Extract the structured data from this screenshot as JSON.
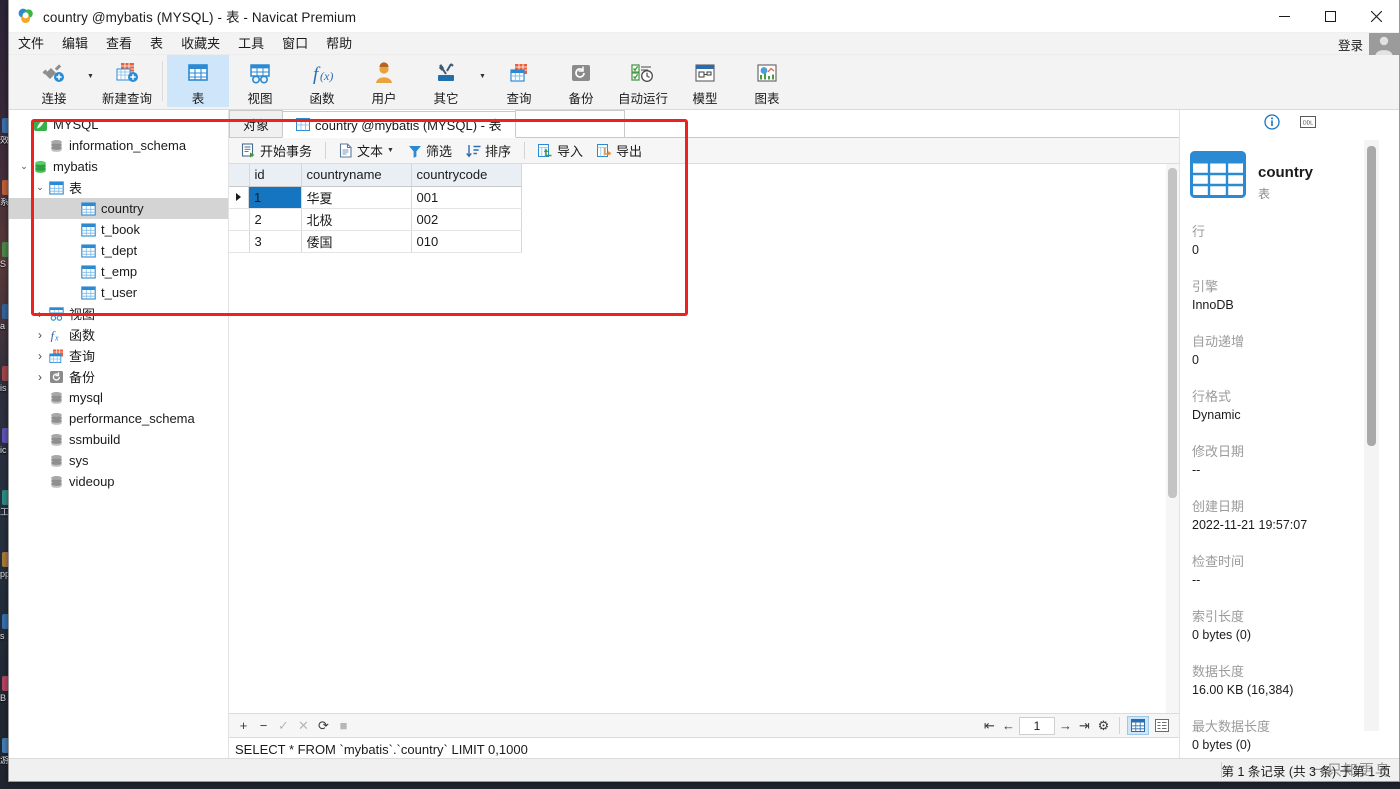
{
  "window": {
    "title": "country @mybatis (MYSQL) - 表 - Navicat Premium",
    "minimize": "—",
    "maximize": "▢",
    "close": "✕"
  },
  "menubar": {
    "items": [
      "文件",
      "编辑",
      "查看",
      "表",
      "收藏夹",
      "工具",
      "窗口",
      "帮助"
    ],
    "login_label": "登录"
  },
  "ribbon": {
    "items": [
      {
        "label": "连接",
        "icon": "connection-icon",
        "has_caret": true
      },
      {
        "label": "新建查询",
        "icon": "new-query-icon",
        "has_caret": false
      },
      {
        "label": "表",
        "icon": "table-icon",
        "selected": true
      },
      {
        "label": "视图",
        "icon": "view-icon",
        "selected": false
      },
      {
        "label": "函数",
        "icon": "function-icon",
        "selected": false
      },
      {
        "label": "用户",
        "icon": "user-icon",
        "selected": false
      },
      {
        "label": "其它",
        "icon": "others-icon",
        "selected": false,
        "has_caret": true
      },
      {
        "label": "查询",
        "icon": "query-icon",
        "selected": false
      },
      {
        "label": "备份",
        "icon": "backup-icon",
        "selected": false
      },
      {
        "label": "自动运行",
        "icon": "automation-icon",
        "selected": false
      },
      {
        "label": "模型",
        "icon": "model-icon",
        "selected": false
      },
      {
        "label": "图表",
        "icon": "chart-icon",
        "selected": false
      }
    ]
  },
  "tree": {
    "nodes": [
      {
        "label": "MYSQL",
        "indent": 0,
        "arrow": "",
        "icon": "connection-leaf-icon",
        "selected": false
      },
      {
        "label": "information_schema",
        "indent": 1,
        "arrow": "",
        "icon": "database-icon",
        "selected": false
      },
      {
        "label": "mybatis",
        "indent": 0,
        "arrow": "v",
        "icon": "database-open-icon",
        "selected": false
      },
      {
        "label": "表",
        "indent": 1,
        "arrow": "v",
        "icon": "table-icon",
        "selected": false
      },
      {
        "label": "country",
        "indent": 3,
        "arrow": "",
        "icon": "table-icon",
        "selected": true
      },
      {
        "label": "t_book",
        "indent": 3,
        "arrow": "",
        "icon": "table-icon",
        "selected": false
      },
      {
        "label": "t_dept",
        "indent": 3,
        "arrow": "",
        "icon": "table-icon",
        "selected": false
      },
      {
        "label": "t_emp",
        "indent": 3,
        "arrow": "",
        "icon": "table-icon",
        "selected": false
      },
      {
        "label": "t_user",
        "indent": 3,
        "arrow": "",
        "icon": "table-icon",
        "selected": false
      },
      {
        "label": "视图",
        "indent": 1,
        "arrow": ">",
        "icon": "view-icon",
        "selected": false
      },
      {
        "label": "函数",
        "indent": 1,
        "arrow": ">",
        "icon": "function-icon",
        "selected": false
      },
      {
        "label": "查询",
        "indent": 1,
        "arrow": ">",
        "icon": "query-icon",
        "selected": false
      },
      {
        "label": "备份",
        "indent": 1,
        "arrow": ">",
        "icon": "backup-icon",
        "selected": false
      },
      {
        "label": "mysql",
        "indent": 1,
        "arrow": "",
        "icon": "database-icon",
        "selected": false
      },
      {
        "label": "performance_schema",
        "indent": 1,
        "arrow": "",
        "icon": "database-icon",
        "selected": false
      },
      {
        "label": "ssmbuild",
        "indent": 1,
        "arrow": "",
        "icon": "database-icon",
        "selected": false
      },
      {
        "label": "sys",
        "indent": 1,
        "arrow": "",
        "icon": "database-icon",
        "selected": false
      },
      {
        "label": "videoup",
        "indent": 1,
        "arrow": "",
        "icon": "database-icon",
        "selected": false
      }
    ]
  },
  "tabs": [
    {
      "label": "对象",
      "icon": "",
      "active": false
    },
    {
      "label": "country @mybatis (MYSQL) - 表",
      "icon": "table-icon",
      "active": true
    }
  ],
  "gridtools": [
    {
      "label": "开始事务",
      "icon": "transaction-icon",
      "caret": false
    },
    {
      "label": "文本",
      "icon": "text-icon",
      "caret": true
    },
    {
      "label": "筛选",
      "icon": "filter-icon",
      "caret": false
    },
    {
      "label": "排序",
      "icon": "sort-icon",
      "caret": false
    },
    {
      "label": "导入",
      "icon": "import-icon",
      "caret": false
    },
    {
      "label": "导出",
      "icon": "export-icon",
      "caret": false
    }
  ],
  "grid": {
    "columns": [
      "id",
      "countryname",
      "countrycode"
    ],
    "rows": [
      {
        "id": "1",
        "countryname": "华夏",
        "countrycode": "001",
        "current": true
      },
      {
        "id": "2",
        "countryname": "北极",
        "countrycode": "002",
        "current": false
      },
      {
        "id": "3",
        "countryname": "倭国",
        "countrycode": "010",
        "current": false
      }
    ]
  },
  "grid_footer": {
    "add": "+",
    "remove": "−",
    "confirm": "✓",
    "cancel": "✕",
    "refresh": "⟳",
    "stop": "■",
    "first_page": "⇤",
    "prev_page": "←",
    "page_value": "1",
    "next_page": "→",
    "last_page": "⇥",
    "settings": "⚙",
    "grid_view": "grid-view-icon",
    "form_view": "form-view-icon"
  },
  "sql": {
    "statement": "SELECT * FROM `mybatis`.`country` LIMIT 0,1000"
  },
  "info": {
    "tabs": [
      "info-icon",
      "ddl-icon"
    ],
    "object_name": "country",
    "object_type": "表",
    "properties": [
      {
        "key": "行",
        "value": "0"
      },
      {
        "key": "引擎",
        "value": "InnoDB"
      },
      {
        "key": "自动递增",
        "value": "0"
      },
      {
        "key": "行格式",
        "value": "Dynamic"
      },
      {
        "key": "修改日期",
        "value": "--"
      },
      {
        "key": "创建日期",
        "value": "2022-11-21 19:57:07"
      },
      {
        "key": "检查时间",
        "value": "--"
      },
      {
        "key": "索引长度",
        "value": "0 bytes (0)"
      },
      {
        "key": "数据长度",
        "value": "16.00 KB (16,384)"
      },
      {
        "key": "最大数据长度",
        "value": "0 bytes (0)"
      }
    ]
  },
  "statusbar": {
    "left": "",
    "record_info": "第 1 条记录 (共 3 条) 于第 1 页",
    "watermark": "一只知更鸟"
  },
  "desktop": {
    "icons": [
      "效率",
      "系统",
      "S",
      "a",
      "is",
      "ic",
      "工具",
      "pp",
      "s",
      "B",
      "游戏"
    ]
  },
  "colors": {
    "accent": "#1675c0",
    "annotation": "#ee2020",
    "ribbon_selected": "#cfe6fa",
    "header": "#eaeff5"
  }
}
